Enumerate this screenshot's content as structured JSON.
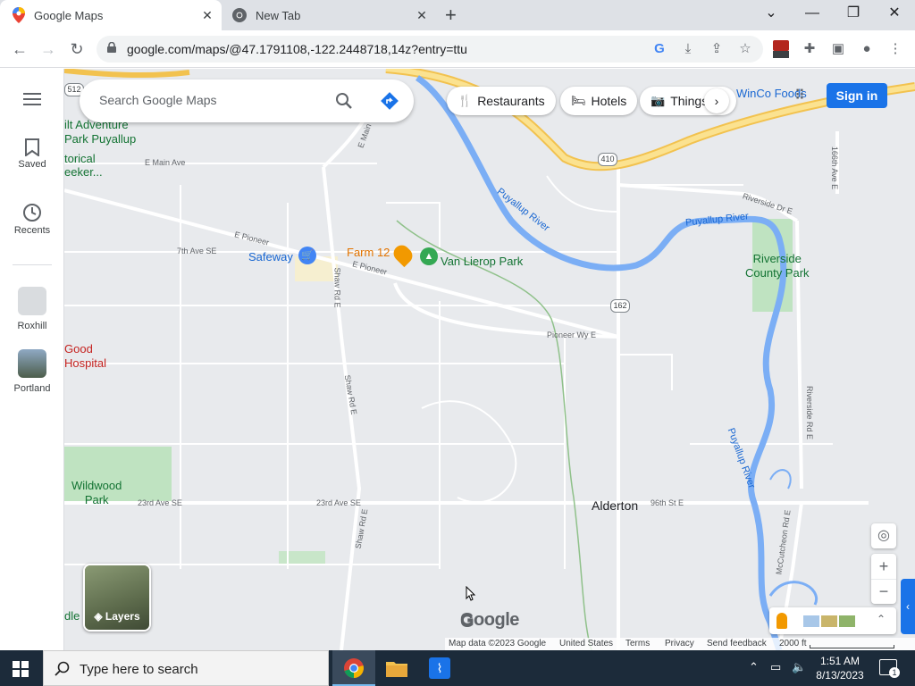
{
  "browser": {
    "tabs": [
      {
        "title": "Google Maps",
        "active": true,
        "icon": "maps-pin-icon"
      },
      {
        "title": "New Tab",
        "active": false,
        "icon": "chrome-icon"
      }
    ],
    "url": "google.com/maps/@47.1791108,-122.2448718,14z?entry=ttu"
  },
  "sidebar": {
    "menu_icon": "hamburger-icon",
    "items": [
      {
        "label": "Saved",
        "icon": "bookmark-icon"
      },
      {
        "label": "Recents",
        "icon": "history-icon"
      },
      {
        "label": "Roxhill",
        "icon": "place-thumbnail"
      },
      {
        "label": "Portland",
        "icon": "place-thumbnail"
      }
    ]
  },
  "search": {
    "placeholder": "Search Google Maps"
  },
  "chips": [
    {
      "label": "Restaurants",
      "icon": "restaurant-icon"
    },
    {
      "label": "Hotels",
      "icon": "hotel-icon"
    },
    {
      "label": "Things",
      "icon": "camera-icon"
    }
  ],
  "signin_label": "Sign in",
  "map_labels": {
    "adventure_park": "ilt Adventure\nPark Puyallup",
    "historical": "torical\neeker...",
    "e_main_ave": "E Main Ave",
    "e_main": "E Main",
    "seventh_ave": "7th Ave SE",
    "e_pioneer_1": "E Pioneer",
    "e_pioneer_2": "E Pioneer",
    "safeway": "Safeway",
    "farm12": "Farm 12",
    "van_lierop": "Van Lierop Park",
    "puyallup_river_1": "Puyallup River",
    "puyallup_river_2": "Puyallup River",
    "puyallup_river_3": "Puyallup River",
    "riverside_dr": "Riverside Dr E",
    "riverside_park": "Riverside\nCounty Park",
    "winco": "WinCo Foods",
    "ave166": "166th Ave E",
    "shaw_rd_1": "Shaw Rd E",
    "shaw_rd_2": "Shaw Rd E",
    "shaw_rd_3": "Shaw Rd E",
    "pioneer_wy": "Pioneer Wy E",
    "route162": "162",
    "route410": "410",
    "route512": "512",
    "good_hospital": "Good\nHospital",
    "riverside_rd": "Riverside Rd E",
    "wildwood": "Wildwood\nPark",
    "ave23_1": "23rd Ave SE",
    "ave23_2": "23rd Ave SE",
    "alderton": "Alderton",
    "st96": "96th St E",
    "mccutcheon": "McCutcheon Rd E",
    "dle": "dle"
  },
  "layers_label": "Layers",
  "footer": {
    "map_data": "Map data ©2023 Google",
    "country": "United States",
    "terms": "Terms",
    "privacy": "Privacy",
    "feedback": "Send feedback",
    "scale": "2000 ft"
  },
  "logo_text": "Google",
  "taskbar": {
    "search_placeholder": "Type here to search",
    "time": "1:51 AM",
    "date": "8/13/2023",
    "notification_count": "1"
  },
  "colors": {
    "accent": "#1a73e8",
    "river": "#7baef5",
    "highway": "#f8d36a",
    "park": "#bfe3c1"
  }
}
